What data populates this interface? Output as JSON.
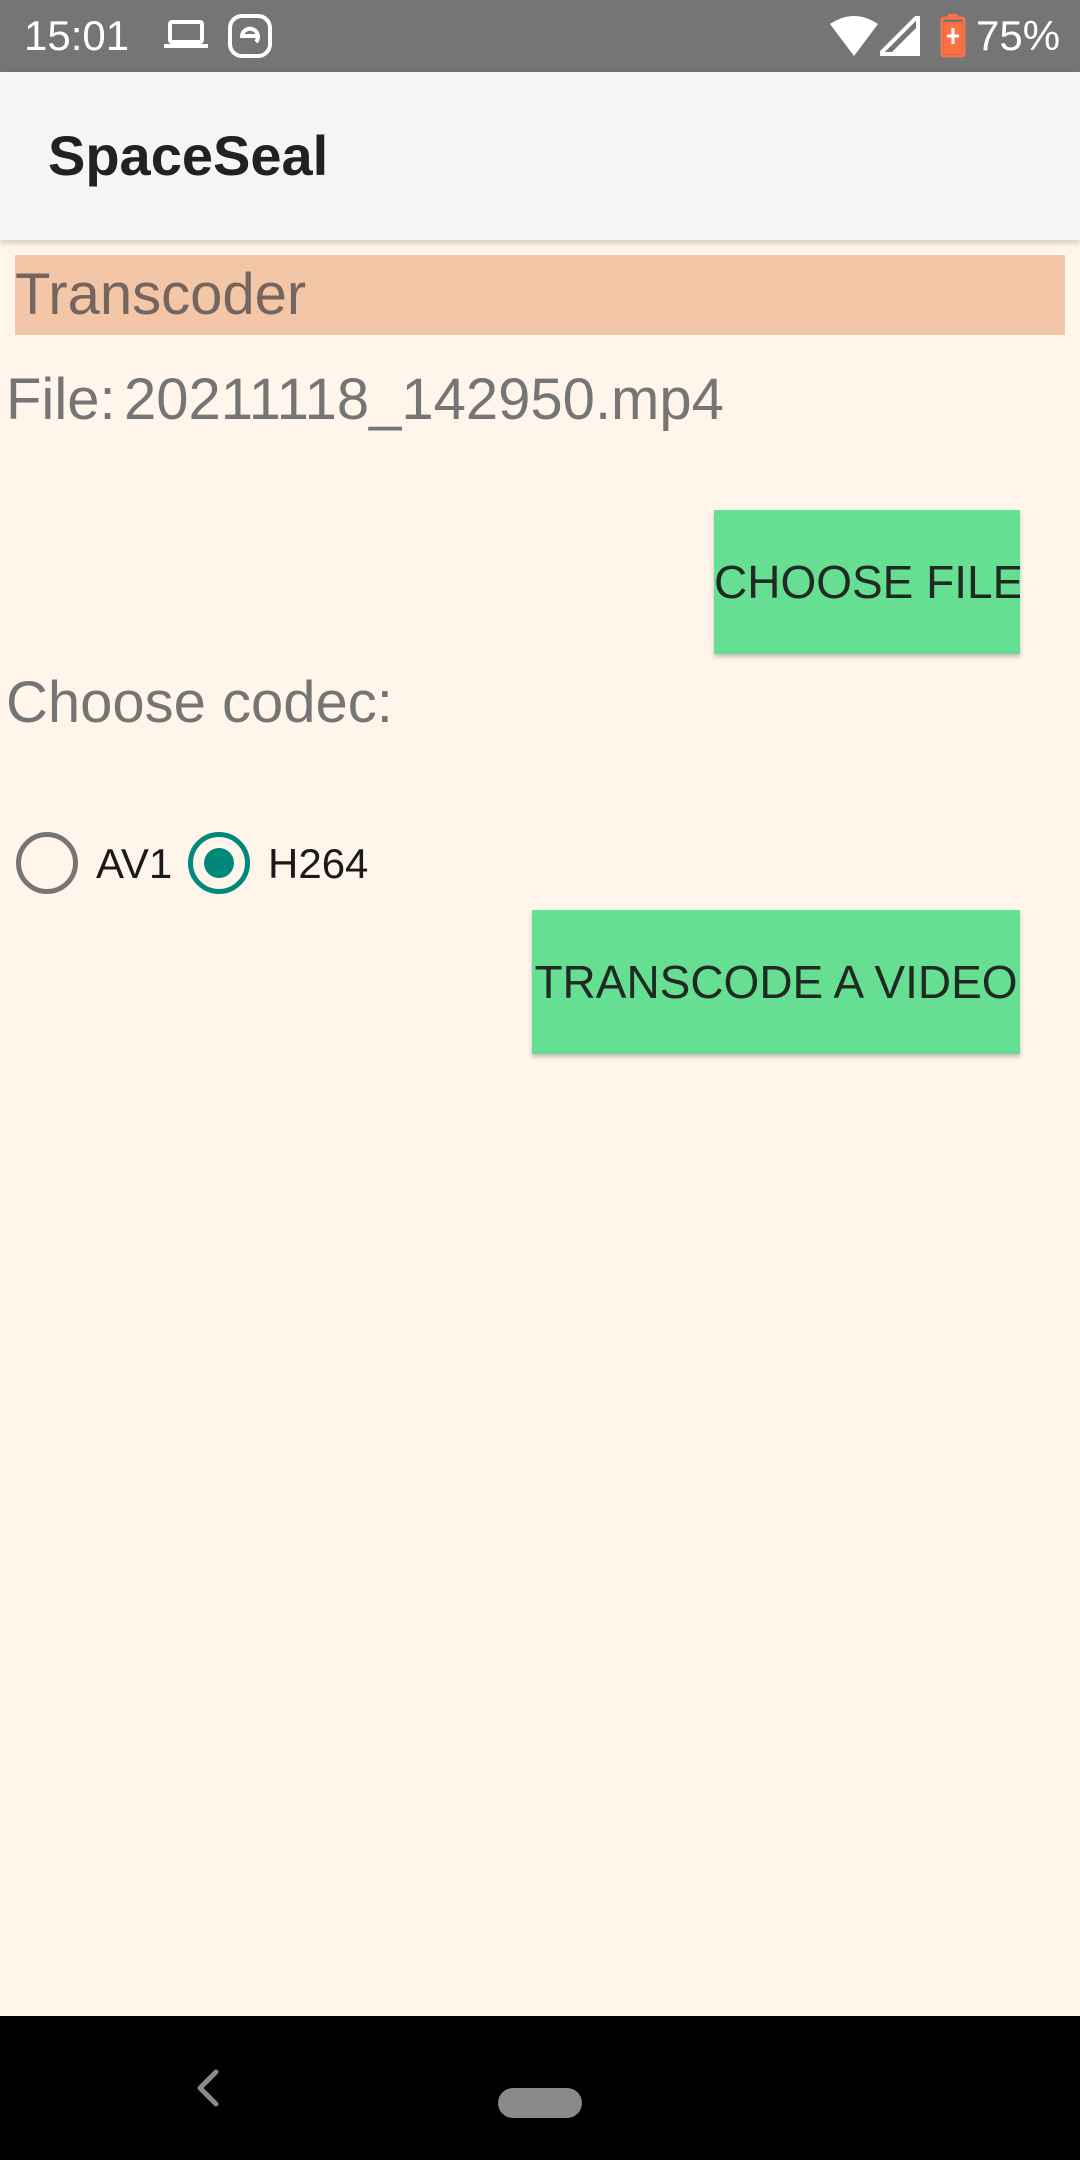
{
  "status_bar": {
    "time": "15:01",
    "battery_percent": "75%",
    "icons": [
      "laptop-icon",
      "e-icon",
      "wifi-icon",
      "signal-icon",
      "battery-icon"
    ]
  },
  "app_bar": {
    "title": "SpaceSeal"
  },
  "main": {
    "section_title": "Transcoder",
    "file_label": "File:",
    "file_name": "20211118_142950.mp4",
    "choose_file_label": "CHOOSE FILE",
    "codec_label": "Choose codec:",
    "codec_options": [
      {
        "label": "AV1",
        "selected": false
      },
      {
        "label": "H264",
        "selected": true
      }
    ],
    "transcode_label": "TRANSCODE A VIDEO"
  },
  "colors": {
    "background": "#fff5ea",
    "section_header": "#f4c6a8",
    "button": "#67df92",
    "radio_accent": "#00897b"
  },
  "nav_bar": {
    "icons": [
      "back-icon",
      "home-pill"
    ]
  }
}
